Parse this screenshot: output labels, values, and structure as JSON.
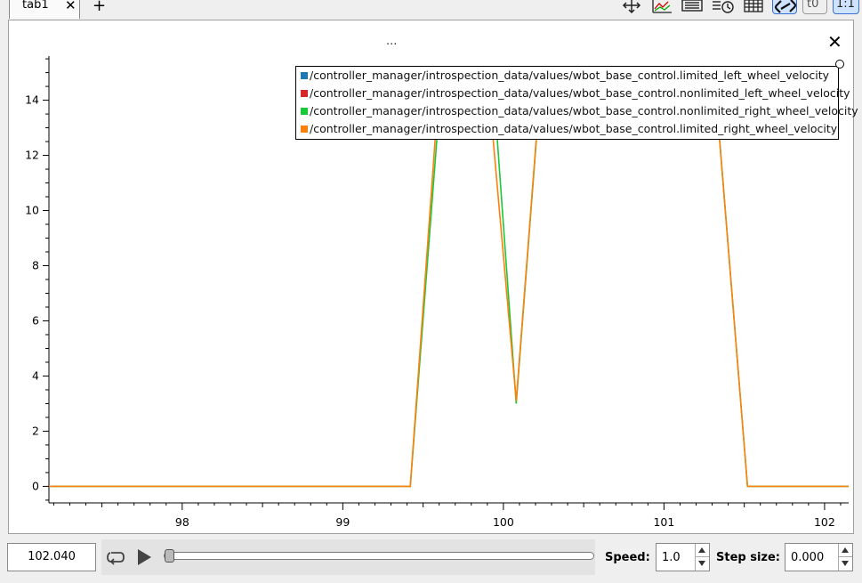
{
  "tabs": [
    {
      "label": "tab1"
    }
  ],
  "toolbar": {
    "tools": [
      {
        "name": "move-icon"
      },
      {
        "name": "line-chart-icon"
      },
      {
        "name": "list-icon"
      },
      {
        "name": "clock-list-icon"
      },
      {
        "name": "grid-icon"
      },
      {
        "name": "link-icon",
        "active": true
      },
      {
        "name": "t0-icon",
        "text": "t0"
      },
      {
        "name": "one-to-one-icon",
        "text": "1:1",
        "active": true
      }
    ]
  },
  "plot": {
    "title": "...",
    "legend": [
      {
        "label": "/controller_manager/introspection_data/values/wbot_base_control.limited_left_wheel_velocity",
        "color": "#1f77b4"
      },
      {
        "label": "/controller_manager/introspection_data/values/wbot_base_control.nonlimited_left_wheel_velocity",
        "color": "#d62728"
      },
      {
        "label": "/controller_manager/introspection_data/values/wbot_base_control.nonlimited_right_wheel_velocity",
        "color": "#1ac938"
      },
      {
        "label": "/controller_manager/introspection_data/values/wbot_base_control.limited_right_wheel_velocity",
        "color": "#ff7f0e"
      }
    ],
    "x_ticks": [
      "98",
      "99",
      "100",
      "101",
      "102"
    ],
    "y_ticks": [
      "0",
      "2",
      "4",
      "6",
      "8",
      "10",
      "12",
      "14"
    ],
    "x_range": [
      97.17,
      102.15
    ],
    "y_range": [
      -0.6,
      15.6
    ],
    "series": [
      {
        "name": "/controller_manager/introspection_data/values/wbot_base_control.nonlimited_right_wheel_velocity",
        "color": "#1ac938",
        "points": [
          [
            97.17,
            0
          ],
          [
            99.42,
            0
          ],
          [
            99.62,
            15.2
          ],
          [
            99.93,
            15.2
          ],
          [
            100.08,
            3.0
          ],
          [
            100.24,
            15.2
          ],
          [
            101.31,
            15.2
          ],
          [
            101.52,
            0
          ],
          [
            102.15,
            0
          ]
        ]
      },
      {
        "name": "/controller_manager/introspection_data/values/wbot_base_control.limited_right_wheel_velocity",
        "color": "#ff7f0e",
        "points": [
          [
            97.17,
            0
          ],
          [
            99.42,
            0
          ],
          [
            99.58,
            13.0
          ],
          [
            99.93,
            13.0
          ],
          [
            100.08,
            3.1
          ],
          [
            100.21,
            13.0
          ],
          [
            101.34,
            13.0
          ],
          [
            101.52,
            0
          ],
          [
            102.15,
            0
          ]
        ]
      }
    ]
  },
  "player": {
    "time_value": "102.040",
    "position_fraction": 0.0,
    "speed_label": "Speed:",
    "speed_value": "1.0",
    "stepsize_label": "Step size:",
    "stepsize_value": "0.000"
  }
}
